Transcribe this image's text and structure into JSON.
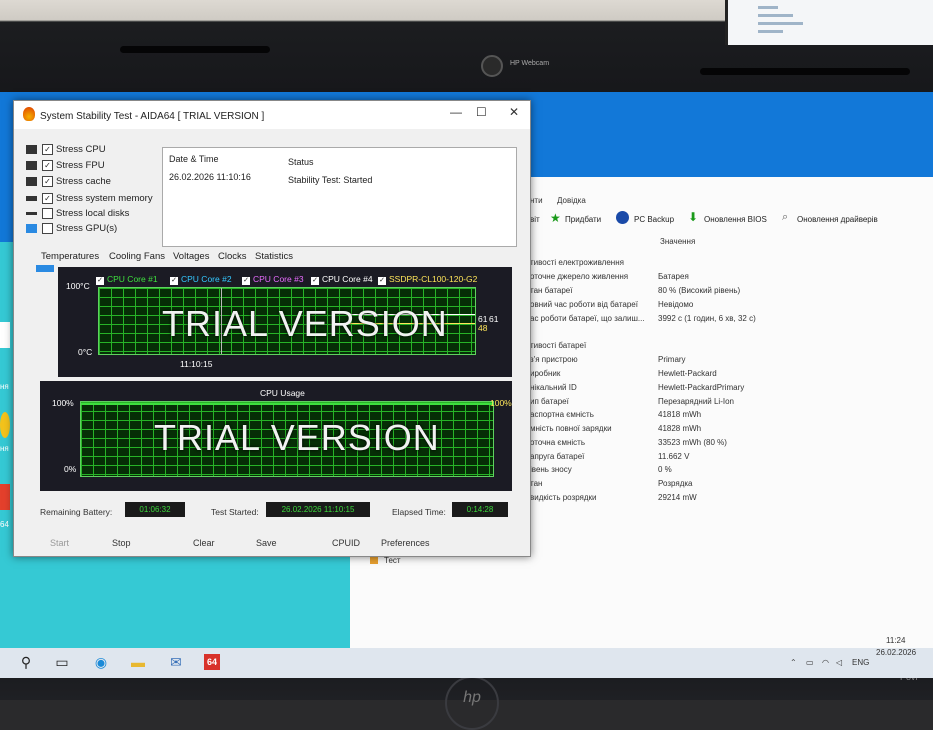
{
  "camera": {
    "label": "HP Webcam"
  },
  "aida": {
    "title": "System Stability Test - AIDA64  [ TRIAL VERSION ]",
    "window_controls": {
      "minimize": "—",
      "maximize": "☐",
      "close": "✕"
    },
    "stress_options": [
      {
        "label": "Stress CPU",
        "checked": true,
        "check": "✓"
      },
      {
        "label": "Stress FPU",
        "checked": true,
        "check": "✓"
      },
      {
        "label": "Stress cache",
        "checked": true,
        "check": "✓"
      },
      {
        "label": "Stress system memory",
        "checked": true,
        "check": "✓"
      },
      {
        "label": "Stress local disks",
        "checked": false,
        "check": ""
      },
      {
        "label": "Stress GPU(s)",
        "checked": false,
        "check": ""
      }
    ],
    "status_table": {
      "headers": [
        "Date & Time",
        "Status"
      ],
      "rows": [
        {
          "datetime": "26.02.2026 11:10:16",
          "status": "Stability Test: Started"
        }
      ]
    },
    "tabs": [
      "Temperatures",
      "Cooling Fans",
      "Voltages",
      "Clocks",
      "Statistics"
    ],
    "temp_graph": {
      "legend": [
        {
          "label": "CPU Core #1",
          "color": "#3ee03e"
        },
        {
          "label": "CPU Core #2",
          "color": "#34c8ff"
        },
        {
          "label": "CPU Core #3",
          "color": "#e86bff"
        },
        {
          "label": "CPU Core #4",
          "color": "#ffffff"
        },
        {
          "label": "SSDPR-CL100-120-G2",
          "color": "#ffe65a"
        }
      ],
      "y_max": "100°C",
      "y_min": "0°C",
      "time_label": "11:10:15",
      "right_values": [
        "61",
        "61",
        "48"
      ],
      "watermark": "TRIAL VERSION"
    },
    "cpu_graph": {
      "title": "CPU Usage",
      "y_max": "100%",
      "y_min": "0%",
      "right_value": "100%",
      "watermark": "TRIAL VERSION"
    },
    "bottom": {
      "remaining_battery_label": "Remaining Battery:",
      "remaining_battery": "01:06:32",
      "test_started_label": "Test Started:",
      "test_started": "26.02.2026 11:10:15",
      "elapsed_label": "Elapsed Time:",
      "elapsed": "0:14:28"
    },
    "buttons": [
      "Start",
      "Stop",
      "Clear",
      "Save",
      "CPUID",
      "Preferences"
    ]
  },
  "bg_app": {
    "menu": [
      "нти",
      "Довідка"
    ],
    "toolbar": [
      "віт",
      "Придбати",
      "PC Backup",
      "Оновлення BIOS",
      "Оновлення драйверів"
    ],
    "column_header": "Значення",
    "sections": [
      {
        "title": "тивості електроживлення",
        "rows": [
          {
            "label": "оточне джерело живлення",
            "value": "Батарея"
          },
          {
            "label": "тан батареї",
            "value": "80 % (Високий рівень)"
          },
          {
            "label": "овний час роботи від батареї",
            "value": "Невідомо"
          },
          {
            "label": "ас роботи батареї, що залиш...",
            "value": "3992 с (1 годин, 6 хв, 32 с)"
          }
        ]
      },
      {
        "title": "тивості батареї",
        "rows": [
          {
            "label": "з'я пристрою",
            "value": "Primary"
          },
          {
            "label": "иробник",
            "value": "Hewlett-Packard"
          },
          {
            "label": "нікальний ID",
            "value": "Hewlett-PackardPrimary"
          },
          {
            "label": "ип батареї",
            "value": "Перезарядний Li-Ion"
          },
          {
            "label": "аспортна ємність",
            "value": "41818 mWh"
          },
          {
            "label": "мність повної зарядки",
            "value": "41828 mWh"
          },
          {
            "label": "оточна ємність",
            "value": "33523 mWh  (80 %)"
          },
          {
            "label": "апруга батареї",
            "value": "11.662 V"
          },
          {
            "label": "івень зносу",
            "value": "0 %"
          },
          {
            "label": "тан",
            "value": "Розрядка"
          },
          {
            "label": "видкість розрядки",
            "value": "29214 mW"
          }
        ]
      }
    ],
    "bottom_item": "Тест"
  },
  "taskbar": {
    "lang": "ENG",
    "time": "11:24",
    "date": "26.02.2026",
    "app_badge": "64"
  },
  "desktop": {
    "side_labels": [
      "ня",
      "ня",
      "64"
    ]
  }
}
